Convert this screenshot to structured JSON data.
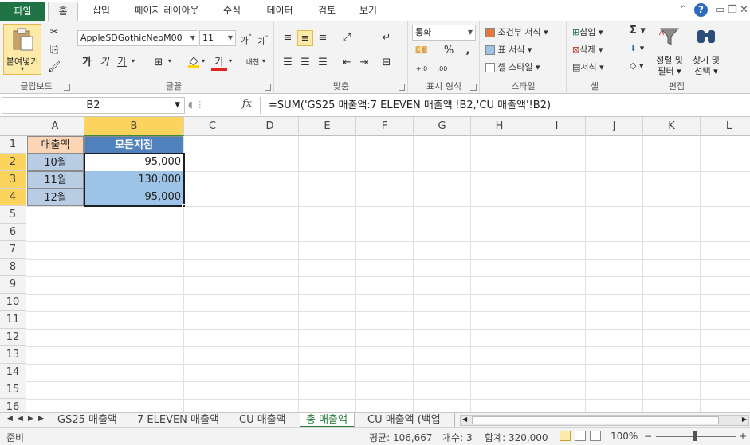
{
  "ribbon_tabs": {
    "file": "파일",
    "items": [
      "홈",
      "삽입",
      "페이지 레이아웃",
      "수식",
      "데이터",
      "검토",
      "보기"
    ],
    "active": "홈"
  },
  "ribbon": {
    "clipboard": {
      "paste_label": "붙여넣기",
      "group_label": "클립보드"
    },
    "font": {
      "font_name": "AppleSDGothicNeoM00",
      "font_size": "11",
      "bold": "가",
      "italic": "가",
      "underline": "가",
      "font_color_glyph": "가",
      "phonetic_glyph": "내천",
      "group_label": "글꼴"
    },
    "alignment": {
      "group_label": "맞춤"
    },
    "number": {
      "format": "통화",
      "percent": "%",
      "comma": ",",
      "inc_decimal": "+.0",
      "dec_decimal": ".00",
      "group_label": "표시 형식"
    },
    "styles": {
      "conditional": "조건부 서식",
      "table_format": "표 서식",
      "cell_styles": "셀 스타일",
      "group_label": "스타일"
    },
    "cells": {
      "insert": "삽입",
      "delete": "삭제",
      "format": "서식",
      "group_label": "셀"
    },
    "editing": {
      "sum_glyph": "Σ",
      "sort_filter_1": "정렬 및",
      "sort_filter_2": "필터",
      "find_select_1": "찾기 및",
      "find_select_2": "선택",
      "group_label": "편집"
    }
  },
  "formula_bar": {
    "name_box": "B2",
    "fx": "fx",
    "formula": "=SUM('GS25 매출액:7 ELEVEN 매출액'!B2,'CU 매출액'!B2)"
  },
  "columns": [
    "A",
    "B",
    "C",
    "D",
    "E",
    "F",
    "G",
    "H",
    "I",
    "J",
    "K",
    "L"
  ],
  "rows": [
    "1",
    "2",
    "3",
    "4",
    "5",
    "6",
    "7",
    "8",
    "9",
    "10",
    "11",
    "12",
    "13",
    "14",
    "15",
    "16"
  ],
  "sheet": {
    "header_a": "매출액",
    "header_b": "모든지점",
    "months": [
      "10월",
      "11월",
      "12월"
    ],
    "values": [
      "95,000",
      "130,000",
      "95,000"
    ]
  },
  "sheet_tabs": {
    "tabs": [
      "GS25 매출액",
      "7 ELEVEN 매출액",
      "CU 매출액",
      "총 매출액",
      "CU 매출액 (백업"
    ],
    "active": "총 매출액"
  },
  "status_bar": {
    "mode": "준비",
    "average": "평균: 106,667",
    "count": "개수: 3",
    "sum": "합계: 320,000",
    "zoom": "100%",
    "zoom_minus": "−",
    "zoom_plus": "+"
  },
  "colors": {
    "accent": "#1f7244",
    "header_a_fill": "#fcd5b4",
    "header_b_fill": "#4f81bd",
    "month_fill": "#b8cce4",
    "value_fill": "#9dc3e6"
  }
}
